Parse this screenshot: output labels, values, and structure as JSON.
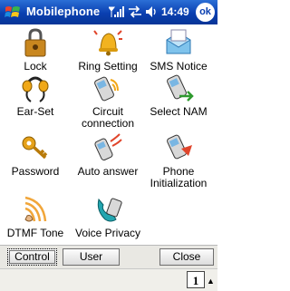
{
  "titlebar": {
    "title": "Mobilephone",
    "time": "14:49",
    "ok_label": "ok"
  },
  "items": [
    {
      "label": "Lock"
    },
    {
      "label": "Ring Setting"
    },
    {
      "label": "SMS Notice"
    },
    {
      "label": "Ear-Set"
    },
    {
      "label": "Circuit connection"
    },
    {
      "label": "Select NAM"
    },
    {
      "label": "Password"
    },
    {
      "label": "Auto answer"
    },
    {
      "label": "Phone Initialization"
    },
    {
      "label": "DTMF Tone"
    },
    {
      "label": "Voice Privacy"
    }
  ],
  "toolbar": {
    "control_label": "Control",
    "user_label": "User",
    "close_label": "Close"
  },
  "menubar": {
    "sip_label": "1",
    "sip_arrow": "▲"
  },
  "colors": {
    "titlebar": "#0a3fb0",
    "toolbar": "#e9e8e3"
  }
}
